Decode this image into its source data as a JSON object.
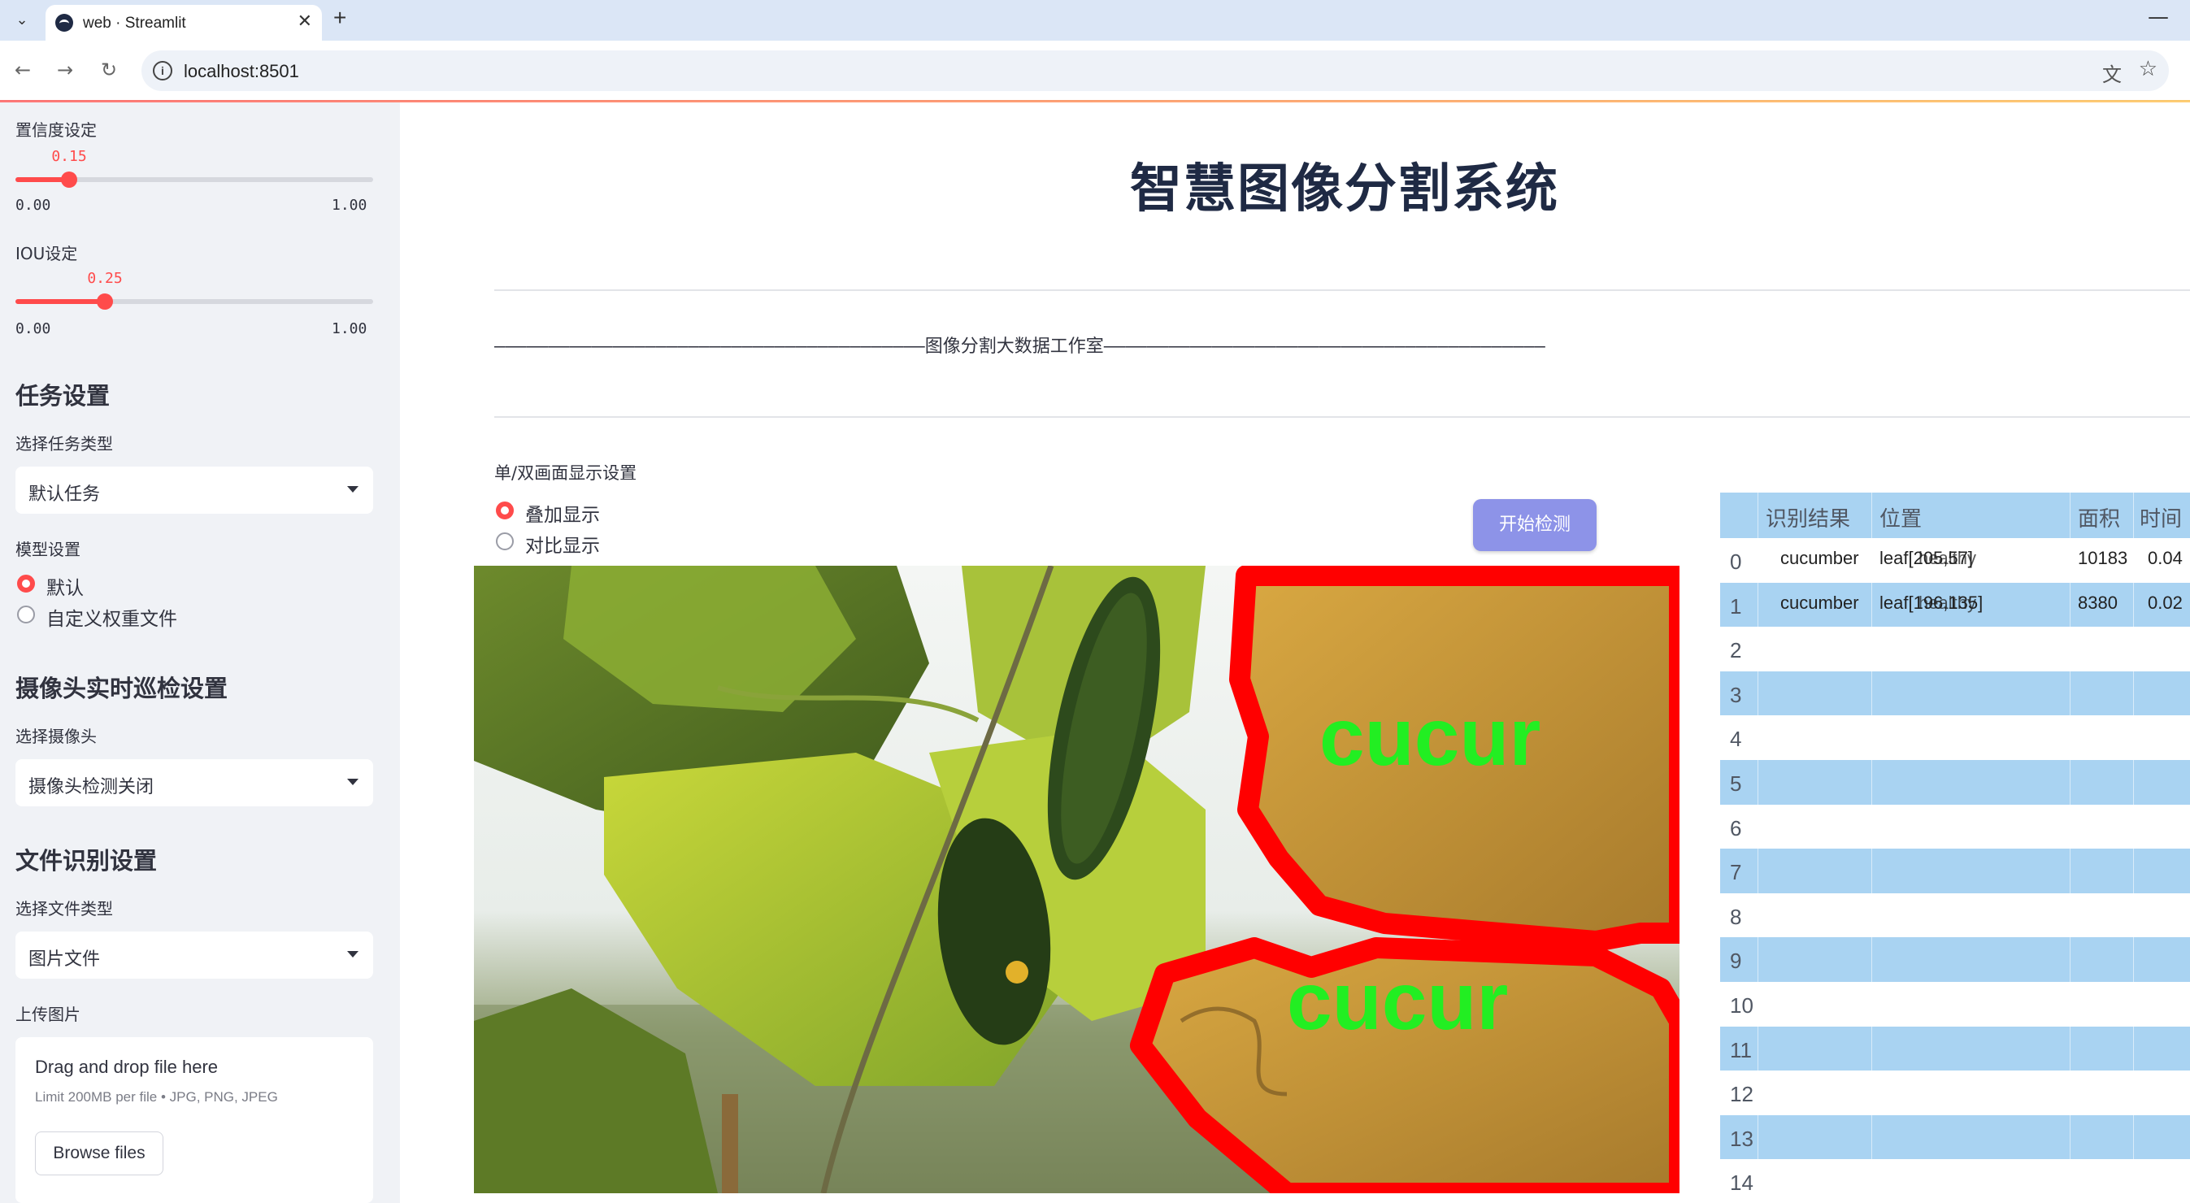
{
  "browser": {
    "tab_title": "web · Streamlit",
    "new_tab": "+",
    "url": "localhost:8501"
  },
  "sidebar": {
    "confidence": {
      "label": "置信度设定",
      "value": "0.15",
      "min": "0.00",
      "max": "1.00",
      "fraction": 0.15
    },
    "iou": {
      "label": "IOU设定",
      "value": "0.25",
      "min": "0.00",
      "max": "1.00",
      "fraction": 0.25
    },
    "task_section": "任务设置",
    "task_type_label": "选择任务类型",
    "task_type_value": "默认任务",
    "model_label": "模型设置",
    "model_options": [
      "默认",
      "自定义权重文件"
    ],
    "model_selected": 0,
    "camera_section": "摄像头实时巡检设置",
    "camera_label": "选择摄像头",
    "camera_value": "摄像头检测关闭",
    "file_section": "文件识别设置",
    "file_type_label": "选择文件类型",
    "file_type_value": "图片文件",
    "upload_label": "上传图片",
    "upload_title": "Drag and drop file here",
    "upload_hint": "Limit 200MB per file • JPG, PNG, JPEG",
    "browse_button": "Browse files"
  },
  "main": {
    "title": "智慧图像分割系统",
    "studio_line": "————————————————————————————————————————图像分割大数据工作室—————————————————————————————————————————",
    "display_label": "单/双画面显示设置",
    "display_options": [
      "叠加显示",
      "对比显示"
    ],
    "display_selected": 0,
    "start_button": "开始检测",
    "overlay_labels": [
      "cucur",
      "cucur"
    ]
  },
  "results_table": {
    "columns": [
      "识别结果",
      "位置",
      "面积",
      "时间"
    ],
    "rows": [
      {
        "index": "0",
        "result": "cucumber",
        "position": "leaf[205,57]",
        "position_overlap": "healthy",
        "area": "10183",
        "time": "0.04"
      },
      {
        "index": "1",
        "result": "cucumber",
        "position": "leaf[196,135]",
        "position_overlap": "healthy",
        "area": "8380",
        "time": "0.02"
      },
      {
        "index": "2"
      },
      {
        "index": "3"
      },
      {
        "index": "4"
      },
      {
        "index": "5"
      },
      {
        "index": "6"
      },
      {
        "index": "7"
      },
      {
        "index": "8"
      },
      {
        "index": "9"
      },
      {
        "index": "10"
      },
      {
        "index": "11"
      },
      {
        "index": "12"
      },
      {
        "index": "13"
      },
      {
        "index": "14"
      }
    ]
  },
  "colors": {
    "accent": "#ff4b4b",
    "sidebar_bg": "#f0f2f6",
    "button": "#8d93e8",
    "table_stripe": "#a9d3f2",
    "mask_outline": "#ff0000",
    "mask_label": "#22ee22"
  }
}
